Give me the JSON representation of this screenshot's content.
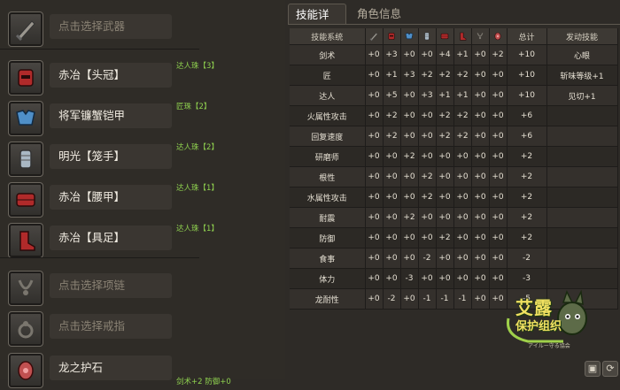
{
  "equipment": [
    {
      "name": "点击选择武器",
      "empty": true,
      "icon": "weapon-icon",
      "deco": ""
    },
    {
      "name": "赤冶【头冠】",
      "empty": false,
      "icon": "helmet-icon",
      "deco": "达人珠【3】"
    },
    {
      "name": "将军镰蟹铠甲",
      "empty": false,
      "icon": "chest-armor-icon",
      "deco": "匠珠【2】"
    },
    {
      "name": "明光【笼手】",
      "empty": false,
      "icon": "gauntlet-icon",
      "deco": "达人珠【2】"
    },
    {
      "name": "赤冶【腰甲】",
      "empty": false,
      "icon": "waist-armor-icon",
      "deco": "达人珠【1】"
    },
    {
      "name": "赤冶【具足】",
      "empty": false,
      "icon": "leg-armor-icon",
      "deco": "达人珠【1】"
    },
    {
      "name": "点击选择项链",
      "empty": true,
      "icon": "necklace-icon",
      "deco": ""
    },
    {
      "name": "点击选择戒指",
      "empty": true,
      "icon": "ring-icon",
      "deco": ""
    },
    {
      "name": "龙之护石",
      "empty": false,
      "icon": "charm-icon",
      "deco": "剑术+2 防御+0"
    }
  ],
  "tabs": {
    "active": "技能详情",
    "inactive": "角色信息"
  },
  "table": {
    "header_left": "技能系统",
    "header_icons": [
      "weapon-icon",
      "helmet-icon",
      "chest-armor-icon",
      "gauntlet-icon",
      "waist-armor-icon",
      "leg-armor-icon",
      "necklace-icon",
      "charm-icon"
    ],
    "header_total": "总计",
    "header_active": "发动技能",
    "rows": [
      {
        "name": "剑术",
        "vals": [
          "+0",
          "+3",
          "+0",
          "+0",
          "+4",
          "+1",
          "+0",
          "+2"
        ],
        "total": "+10",
        "active": "心眼"
      },
      {
        "name": "匠",
        "vals": [
          "+0",
          "+1",
          "+3",
          "+2",
          "+2",
          "+2",
          "+0",
          "+0"
        ],
        "total": "+10",
        "active": "斩味等级+1"
      },
      {
        "name": "达人",
        "vals": [
          "+0",
          "+5",
          "+0",
          "+3",
          "+1",
          "+1",
          "+0",
          "+0"
        ],
        "total": "+10",
        "active": "见切+1"
      },
      {
        "name": "火属性攻击",
        "vals": [
          "+0",
          "+2",
          "+0",
          "+0",
          "+2",
          "+2",
          "+0",
          "+0"
        ],
        "total": "+6",
        "active": ""
      },
      {
        "name": "回复速度",
        "vals": [
          "+0",
          "+2",
          "+0",
          "+0",
          "+2",
          "+2",
          "+0",
          "+0"
        ],
        "total": "+6",
        "active": ""
      },
      {
        "name": "研磨师",
        "vals": [
          "+0",
          "+0",
          "+2",
          "+0",
          "+0",
          "+0",
          "+0",
          "+0"
        ],
        "total": "+2",
        "active": ""
      },
      {
        "name": "根性",
        "vals": [
          "+0",
          "+0",
          "+0",
          "+2",
          "+0",
          "+0",
          "+0",
          "+0"
        ],
        "total": "+2",
        "active": ""
      },
      {
        "name": "水属性攻击",
        "vals": [
          "+0",
          "+0",
          "+0",
          "+2",
          "+0",
          "+0",
          "+0",
          "+0"
        ],
        "total": "+2",
        "active": ""
      },
      {
        "name": "耐震",
        "vals": [
          "+0",
          "+0",
          "+2",
          "+0",
          "+0",
          "+0",
          "+0",
          "+0"
        ],
        "total": "+2",
        "active": ""
      },
      {
        "name": "防御",
        "vals": [
          "+0",
          "+0",
          "+0",
          "+0",
          "+2",
          "+0",
          "+0",
          "+0"
        ],
        "total": "+2",
        "active": ""
      },
      {
        "name": "食事",
        "vals": [
          "+0",
          "+0",
          "+0",
          "-2",
          "+0",
          "+0",
          "+0",
          "+0"
        ],
        "total": "-2",
        "active": ""
      },
      {
        "name": "体力",
        "vals": [
          "+0",
          "+0",
          "-3",
          "+0",
          "+0",
          "+0",
          "+0",
          "+0"
        ],
        "total": "-3",
        "active": ""
      },
      {
        "name": "龙耐性",
        "vals": [
          "+0",
          "-2",
          "+0",
          "-1",
          "-1",
          "-1",
          "+0",
          "+0"
        ],
        "total": "-5",
        "active": ""
      }
    ]
  },
  "logo": {
    "line1": "艾露",
    "line2": "保护组织",
    "line3": "アイルー守る協会"
  },
  "colors": {
    "deco_green": "#8fd14f",
    "background": "#2e2b27",
    "logo_yellow": "#f0e060"
  }
}
